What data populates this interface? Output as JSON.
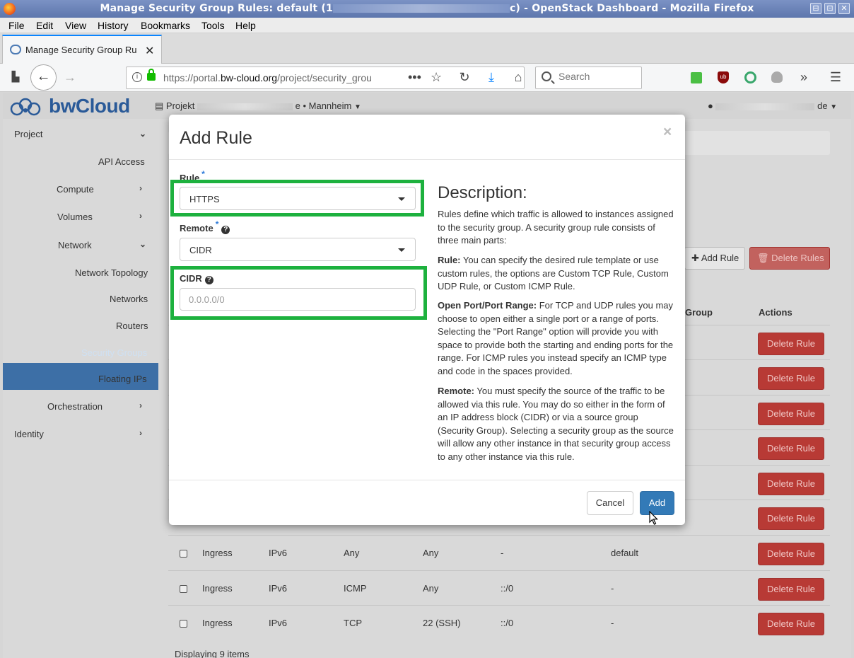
{
  "window": {
    "title": "Manage Security Group Rules: default (1",
    "title_suffix": "c) - OpenStack Dashboard - Mozilla Firefox",
    "controls": [
      "⊟",
      "⊡",
      "✕"
    ]
  },
  "menubar": [
    "File",
    "Edit",
    "View",
    "History",
    "Bookmarks",
    "Tools",
    "Help"
  ],
  "tab": {
    "title": "Manage Security Group Ru"
  },
  "navbar": {
    "url_prefix": "https://portal.",
    "url_host": "bw-cloud.org",
    "url_path": "/project/security_grou",
    "search_placeholder": "Search"
  },
  "header": {
    "brand": "bwCloud",
    "project_label": "Projekt",
    "project_suffix": "e • Mannheim",
    "user_suffix": "de"
  },
  "sidebar": {
    "items": [
      "Project",
      "API Access",
      "Compute",
      "Volumes",
      "Network",
      "Network Topology",
      "Networks",
      "Routers",
      "Security Groups",
      "Floating IPs",
      "Orchestration",
      "Identity"
    ],
    "active": "Security Groups"
  },
  "content": {
    "add_rule": "Add Rule",
    "delete_rules": "Delete Rules",
    "col_group": "Group",
    "col_actions": "Actions",
    "delete_label": "Delete Rule",
    "rows": [
      {
        "direction": "Ingress",
        "ethertype": "IPv6",
        "protocol": "Any",
        "port": "Any",
        "cidr": "-",
        "group": "default"
      },
      {
        "direction": "Ingress",
        "ethertype": "IPv6",
        "protocol": "ICMP",
        "port": "Any",
        "cidr": "::/0",
        "group": "-"
      },
      {
        "direction": "Ingress",
        "ethertype": "IPv6",
        "protocol": "TCP",
        "port": "22 (SSH)",
        "cidr": "::/0",
        "group": "-"
      }
    ],
    "footer": "Displaying 9 items"
  },
  "modal": {
    "title": "Add Rule",
    "close": "×",
    "rule_label": "Rule",
    "rule_value": "HTTPS",
    "remote_label": "Remote",
    "remote_value": "CIDR",
    "cidr_label": "CIDR",
    "cidr_placeholder": "0.0.0.0/0",
    "required_mark": "*",
    "description_title": "Description:",
    "desc_intro": "Rules define which traffic is allowed to instances assigned to the security group. A security group rule consists of three main parts:",
    "desc_rule_head": "Rule:",
    "desc_rule": " You can specify the desired rule template or use custom rules, the options are Custom TCP Rule, Custom UDP Rule, or Custom ICMP Rule.",
    "desc_port_head": "Open Port/Port Range:",
    "desc_port": " For TCP and UDP rules you may choose to open either a single port or a range of ports. Selecting the \"Port Range\" option will provide you with space to provide both the starting and ending ports for the range. For ICMP rules you instead specify an ICMP type and code in the spaces provided.",
    "desc_remote_head": "Remote:",
    "desc_remote": " You must specify the source of the traffic to be allowed via this rule. You may do so either in the form of an IP address block (CIDR) or via a source group (Security Group). Selecting a security group as the source will allow any other instance in that security group access to any other instance via this rule.",
    "cancel": "Cancel",
    "add": "Add"
  },
  "colors": {
    "highlight": "#1db13e",
    "primary": "#337ab7",
    "danger": "#b83a35",
    "sidebar_active": "#3d6fa6",
    "brand": "#2a5a98"
  }
}
